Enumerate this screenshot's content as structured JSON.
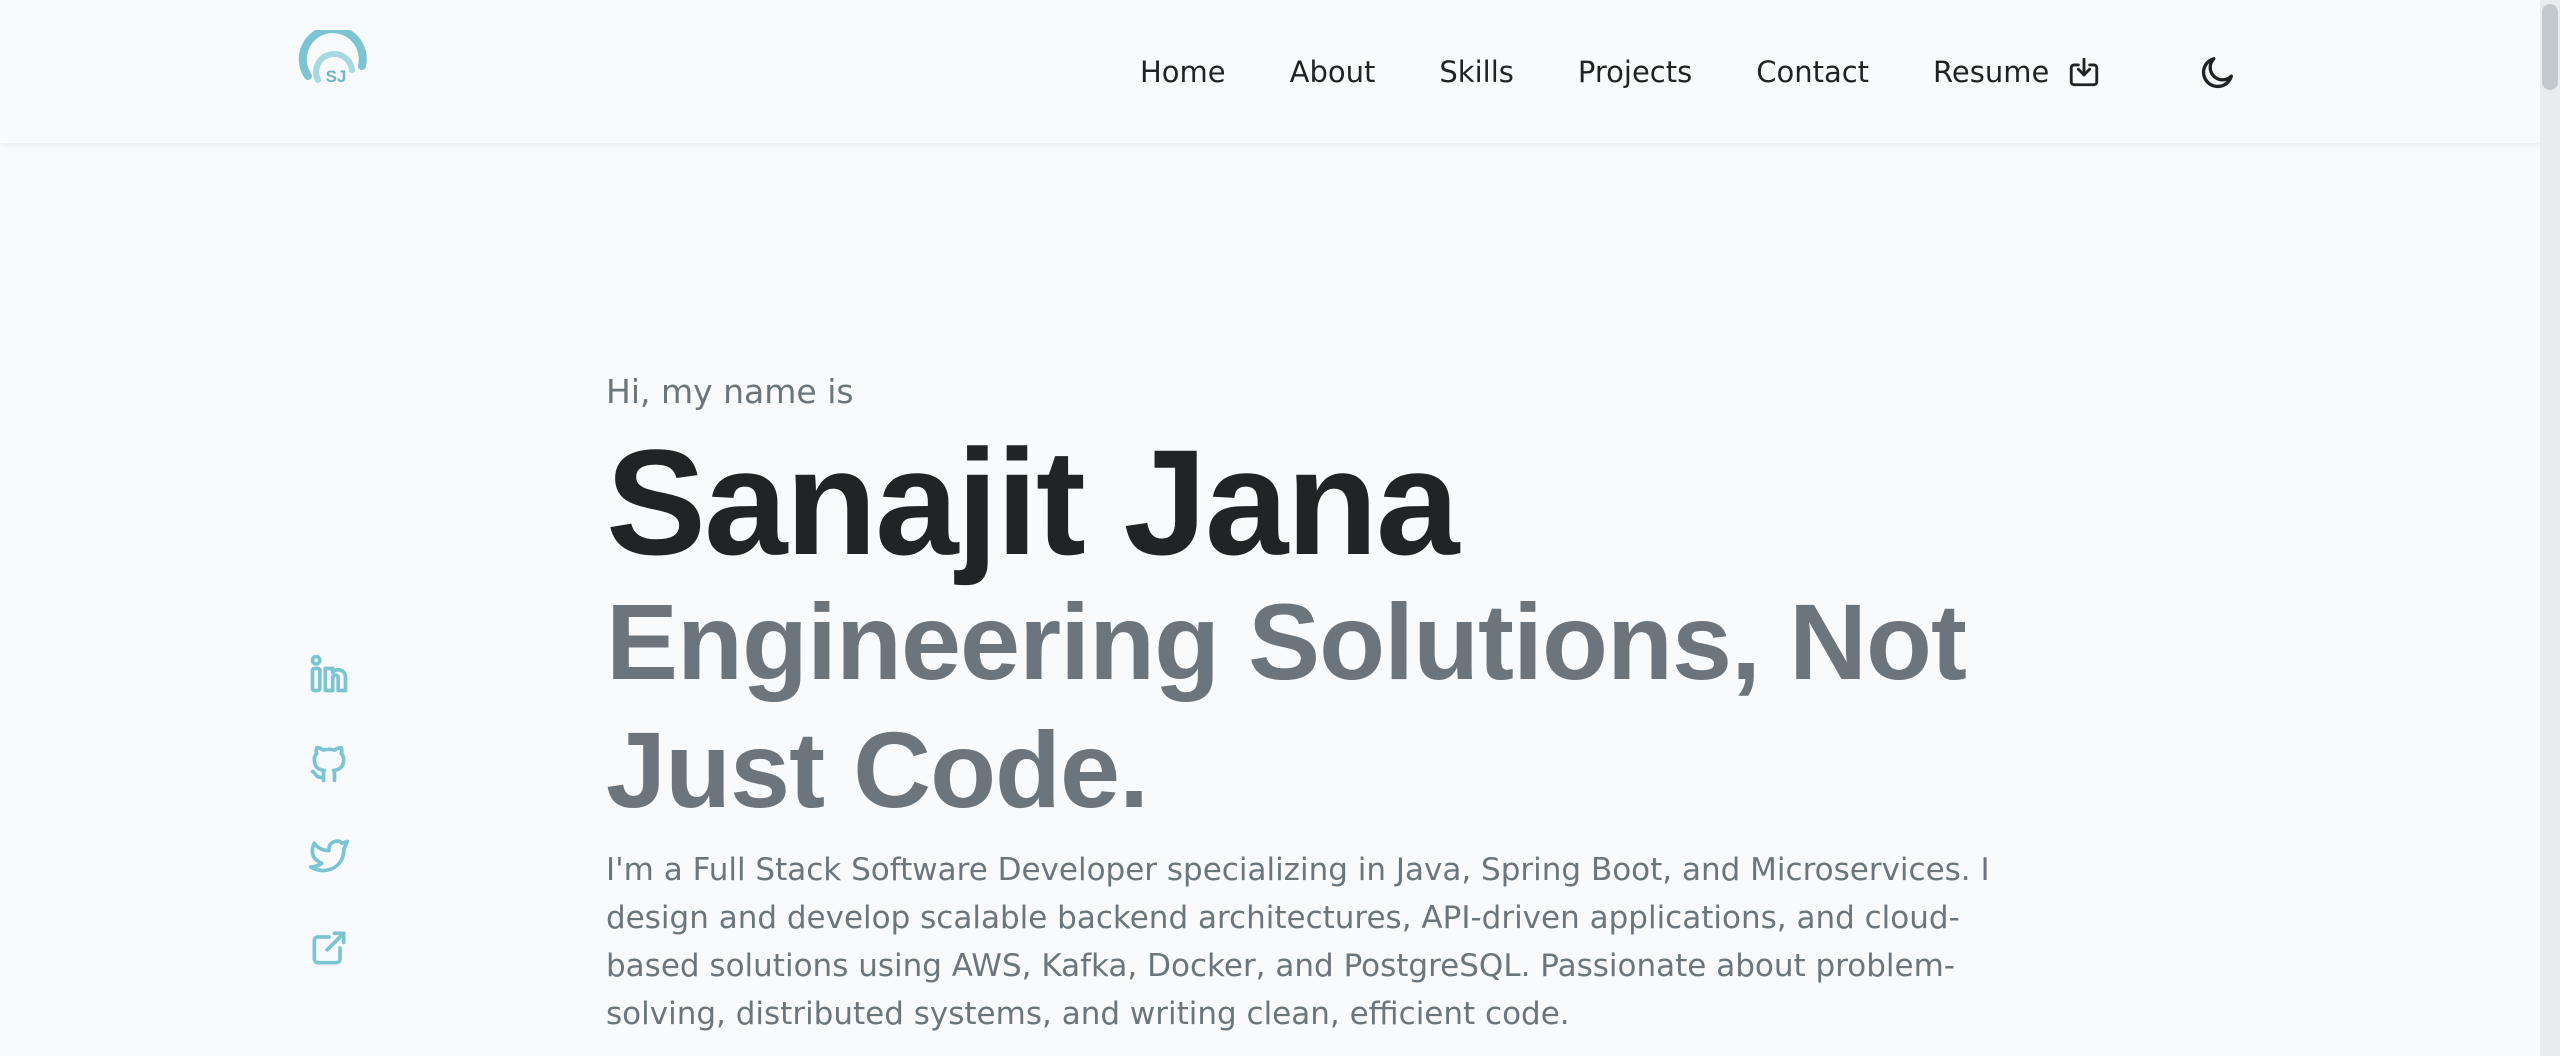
{
  "brand": {
    "logo_text": "SJ",
    "accent": "#7cc4d2"
  },
  "nav": {
    "items": [
      {
        "label": "Home"
      },
      {
        "label": "About"
      },
      {
        "label": "Skills"
      },
      {
        "label": "Projects"
      },
      {
        "label": "Contact"
      }
    ],
    "resume_label": "Resume",
    "resume_icon": "download-icon",
    "theme_icon": "moon-icon"
  },
  "social": [
    {
      "icon": "linkedin-icon"
    },
    {
      "icon": "github-icon"
    },
    {
      "icon": "twitter-icon"
    },
    {
      "icon": "external-link-icon"
    }
  ],
  "hero": {
    "greeting": "Hi, my name is",
    "name": "Sanajit Jana",
    "tagline": "Engineering Solutions, Not Just Code.",
    "bio": "I'm a Full Stack Software Developer specializing in Java, Spring Boot, and Microservices. I design and develop scalable backend architectures, API-driven applications, and cloud-based solutions using AWS, Kafka, Docker, and PostgreSQL. Passionate about problem-solving, distributed systems, and writing clean, efficient code."
  },
  "colors": {
    "background": "#f8fafc",
    "heading": "#202427",
    "muted": "#6c757b",
    "accent": "#7cc4d2"
  }
}
